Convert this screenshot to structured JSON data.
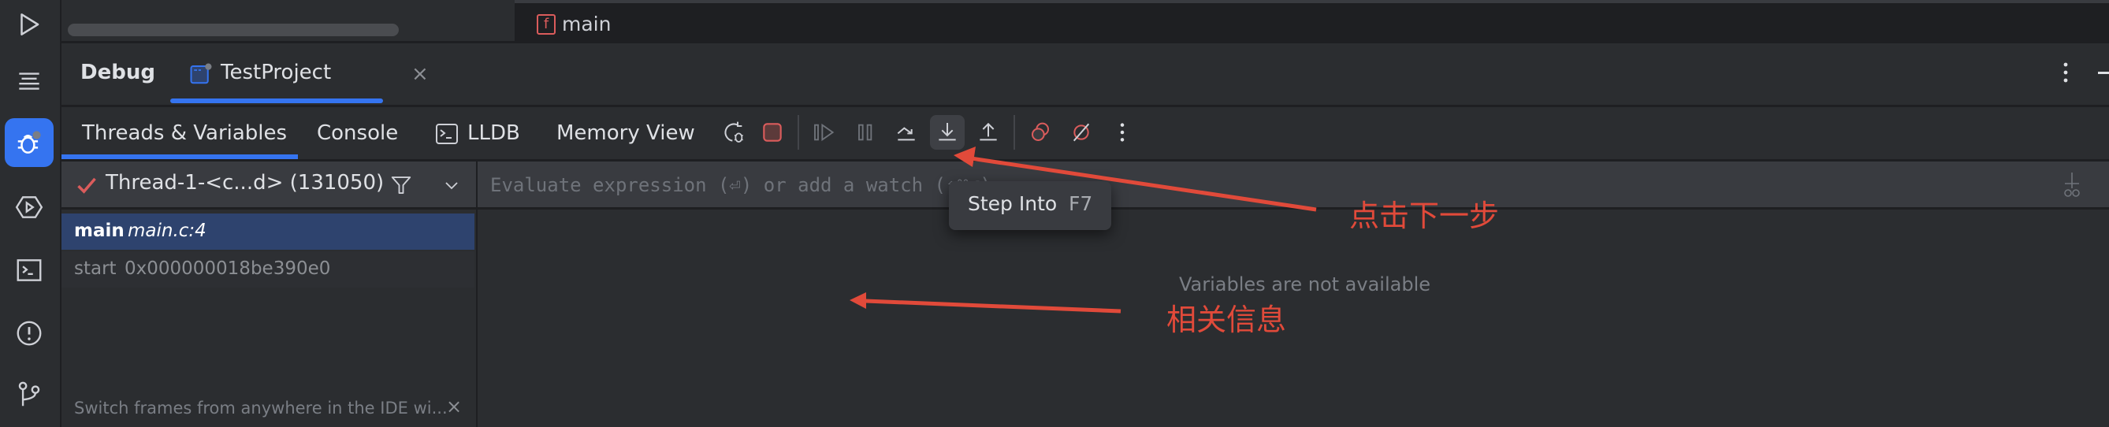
{
  "activity_bar": {
    "items": [
      {
        "name": "run",
        "icon": "play-icon"
      },
      {
        "name": "structure",
        "icon": "list-icon"
      },
      {
        "name": "debug",
        "icon": "bug-icon",
        "active": true
      },
      {
        "name": "services",
        "icon": "hexagon-play-icon"
      },
      {
        "name": "terminal",
        "icon": "terminal-icon"
      },
      {
        "name": "problems",
        "icon": "exclamation-icon"
      },
      {
        "name": "git",
        "icon": "git-branch-icon"
      }
    ]
  },
  "editor": {
    "tab_label": "main",
    "tab_badge": "f"
  },
  "tool_window": {
    "title": "Debug",
    "session_tab": "TestProject",
    "session_close": "×"
  },
  "debug_toolbar": {
    "tabs": [
      "Threads & Variables",
      "Console",
      "LLDB",
      "Memory View"
    ],
    "active_tab": "Threads & Variables",
    "actions": [
      {
        "name": "rerun-debug",
        "icon": "rerun-debug-icon",
        "enabled": true
      },
      {
        "name": "stop",
        "icon": "stop-icon",
        "enabled": true
      },
      {
        "name": "resume",
        "icon": "resume-icon",
        "enabled": false
      },
      {
        "name": "pause",
        "icon": "pause-icon",
        "enabled": false
      },
      {
        "name": "step-over",
        "icon": "step-over-icon",
        "enabled": true
      },
      {
        "name": "step-into",
        "icon": "step-into-icon",
        "enabled": true,
        "hovered": true
      },
      {
        "name": "step-out",
        "icon": "step-out-icon",
        "enabled": true
      },
      {
        "name": "view-breakpoints",
        "icon": "breakpoints-icon",
        "enabled": true
      },
      {
        "name": "mute-breakpoints",
        "icon": "mute-breakpoints-icon",
        "enabled": true
      },
      {
        "name": "more",
        "icon": "more-vertical-icon",
        "enabled": true
      }
    ]
  },
  "threads": {
    "current_thread": "Thread-1-<c...d> (131050)",
    "frames": [
      {
        "function": "main",
        "location": "main.c:4",
        "selected": true
      },
      {
        "function": "start",
        "location": "0x000000018be390e0",
        "selected": false
      }
    ],
    "hint": "Switch frames from anywhere in the IDE wi...",
    "hint_close": "×"
  },
  "variables": {
    "eval_placeholder": "Evaluate expression (⏎) or add a watch (⇧⌘⏎)",
    "eval_value": "",
    "empty_message": "Variables are not available"
  },
  "tooltip": {
    "label": "Step Into",
    "shortcut": "F7"
  },
  "annotations": [
    {
      "text": "点击下一步",
      "points_to": "step-into-button"
    },
    {
      "text": "相关信息",
      "points_to": "variables-panel"
    }
  ],
  "colors": {
    "accent": "#3574f0",
    "annotation": "#e14a3a",
    "stop": "#db5c5c",
    "selection": "#2e436e"
  }
}
